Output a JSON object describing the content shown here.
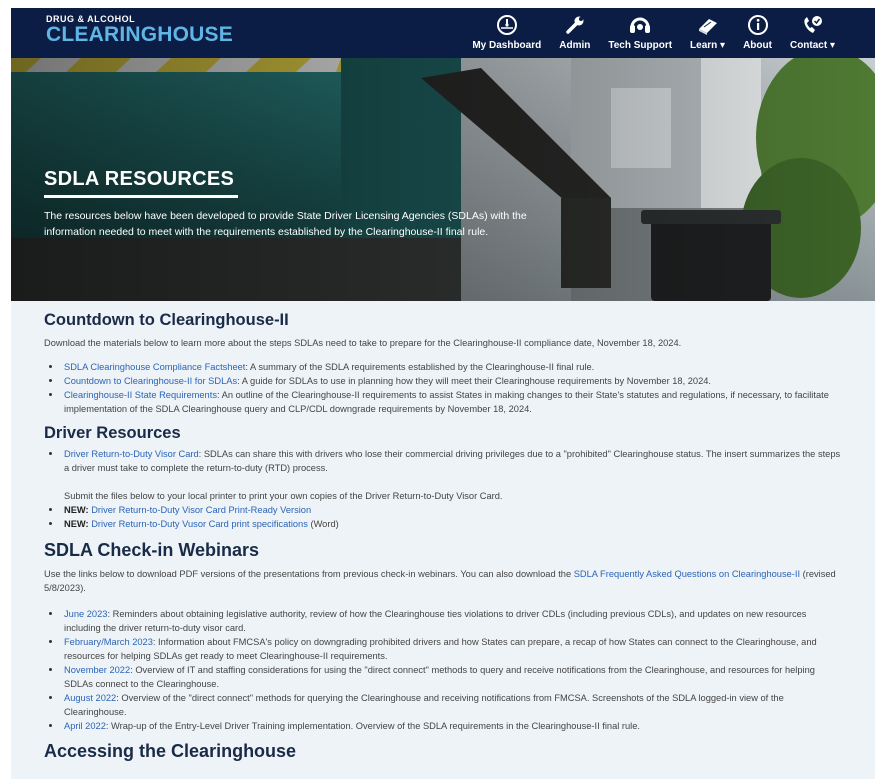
{
  "nav": {
    "logo_top": "DRUG & ALCOHOL",
    "logo_main": "CLEARINGHOUSE",
    "items": [
      {
        "label": "My Dashboard",
        "icon": "dashboard-gauge-icon"
      },
      {
        "label": "Admin",
        "icon": "wrench-icon"
      },
      {
        "label": "Tech Support",
        "icon": "headset-icon"
      },
      {
        "label": "Learn ▾",
        "icon": "book-icon"
      },
      {
        "label": "About",
        "icon": "info-icon"
      },
      {
        "label": "Contact ▾",
        "icon": "phone-icon"
      }
    ]
  },
  "hero": {
    "title": "SDLA RESOURCES",
    "text": "The resources below have been developed to provide State Driver Licensing Agencies (SDLAs) with the information needed to meet with the requirements established by the Clearinghouse-II final rule."
  },
  "countdown": {
    "heading": "Countdown to Clearinghouse-II",
    "intro": "Download the materials below to learn more about the steps SDLAs need to take to prepare for the Clearinghouse-II compliance date, November 18, 2024.",
    "items": [
      {
        "link": "SDLA Clearinghouse Compliance Factsheet",
        "text": ": A summary of the SDLA requirements established by the Clearinghouse-II final rule."
      },
      {
        "link": "Countdown to Clearinghouse-II for SDLAs",
        "text": ": A guide for SDLAs to use in planning how they will meet their Clearinghouse requirements by November 18, 2024."
      },
      {
        "link": "Clearinghouse-II State Requirements",
        "text": ": An outline of the Clearinghouse-II requirements to assist States in making changes to their State's statutes and regulations, if necessary, to facilitate implementation of the SDLA Clearinghouse query and CLP/CDL downgrade requirements by November 18, 2024."
      }
    ]
  },
  "driver": {
    "heading": "Driver Resources",
    "visor_link": "Driver Return-to-Duty Visor Card",
    "visor_text": ": SDLAs can share this with drivers who lose their commercial driving privileges due to a \"prohibited\" Clearinghouse status. The insert summarizes the steps a driver must take to complete the return-to-duty (RTD) process.",
    "submit_text": "Submit the files below to your local printer to print your own copies of the Driver Return-to-Duty Visor Card.",
    "new_label": "NEW:",
    "new_items": [
      {
        "link": "Driver Return-to-Duty Visor Card Print-Ready Version",
        "suffix": ""
      },
      {
        "link": "Driver Return-to-Duty Vusor Card print specifications",
        "suffix": " (Word)"
      }
    ]
  },
  "webinars": {
    "heading": "SDLA Check-in Webinars",
    "intro": "Use the links below to download PDF versions of the presentations from previous check-in webinars. You can also download the ",
    "faq_link": "SDLA Frequently Asked Questions on Clearinghouse-II",
    "intro_suffix": " (revised 5/8/2023).",
    "items": [
      {
        "link": "June 2023",
        "text": ": Reminders about obtaining legislative authority, review of how the Clearinghouse ties violations to driver CDLs (including previous CDLs), and updates on new resources including the driver return-to-duty visor card."
      },
      {
        "link": "February/March 2023",
        "text": ": Information about FMCSA's policy on downgrading prohibited drivers and how States can prepare, a recap of how States can connect to the Clearinghouse, and resources for helping SDLAs get ready to meet Clearinghouse-II requirements."
      },
      {
        "link": "November 2022",
        "text": ": Overview of IT and staffing considerations for using the \"direct connect\" methods to query and receive notifications from the Clearinghouse, and resources for helping SDLAs connect to the Clearinghouse."
      },
      {
        "link": "August 2022",
        "text": ": Overview of the \"direct connect\" methods for querying the Clearinghouse and receiving notifications from FMCSA. Screenshots of the SDLA logged-in view of the Clearinghouse."
      },
      {
        "link": "April 2022",
        "text": ": Wrap-up of the Entry-Level Driver Training implementation. Overview of the SDLA requirements in the Clearinghouse-II final rule."
      }
    ]
  },
  "next_heading": "Accessing the Clearinghouse"
}
